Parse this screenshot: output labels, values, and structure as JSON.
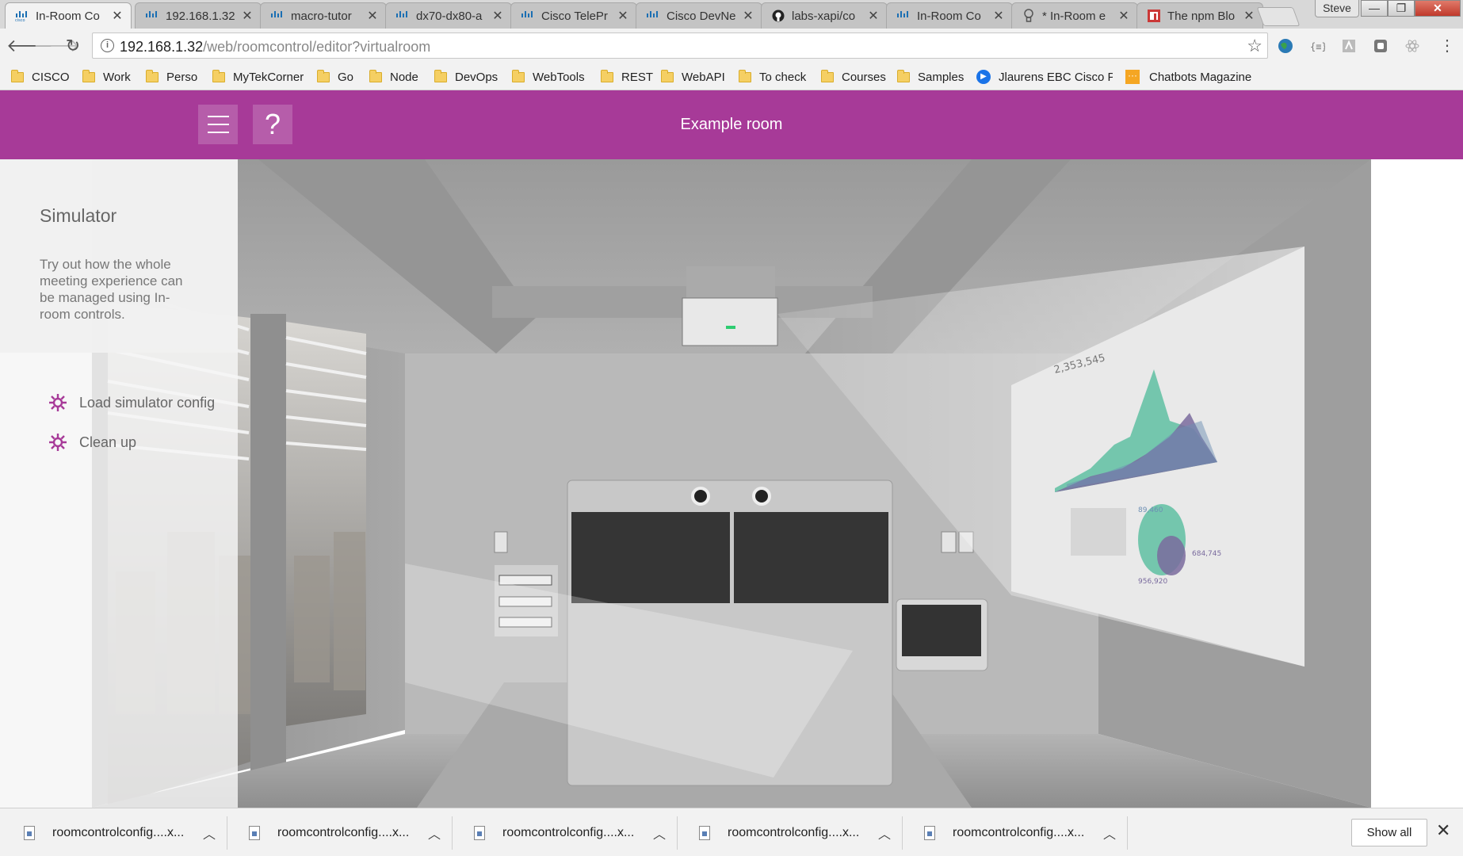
{
  "tabs": [
    {
      "title": "In-Room Co",
      "icon": "cisco-icon",
      "active": true
    },
    {
      "title": "192.168.1.32",
      "icon": "cisco-icon"
    },
    {
      "title": "macro-tutor",
      "icon": "cisco-icon"
    },
    {
      "title": "dx70-dx80-a",
      "icon": "cisco-icon"
    },
    {
      "title": "Cisco TelePr",
      "icon": "cisco-icon"
    },
    {
      "title": "Cisco DevNe",
      "icon": "cisco-icon"
    },
    {
      "title": "labs-xapi/co",
      "icon": "github-icon"
    },
    {
      "title": "In-Room Co",
      "icon": "cisco-icon"
    },
    {
      "title": "* In-Room e",
      "icon": "lightbulb-icon"
    },
    {
      "title": "The npm Blo",
      "icon": "npm-icon"
    }
  ],
  "window": {
    "profile": "Steve",
    "minimize": "—",
    "maximize": "❐",
    "close": "✕"
  },
  "address": {
    "host": "192.168.1.32",
    "path": "/web/roomcontrol/editor?virtualroom"
  },
  "bookmarks": [
    {
      "label": "CISCO"
    },
    {
      "label": "Work"
    },
    {
      "label": "Perso"
    },
    {
      "label": "MyTekCorner"
    },
    {
      "label": "Go"
    },
    {
      "label": "Node"
    },
    {
      "label": "DevOps"
    },
    {
      "label": "WebTools"
    },
    {
      "label": "REST"
    },
    {
      "label": "WebAPI"
    },
    {
      "label": "To check"
    },
    {
      "label": "Courses"
    },
    {
      "label": "Samples"
    },
    {
      "label": "Jlaurens EBC Cisco Pr"
    },
    {
      "label": "Chatbots Magazine"
    }
  ],
  "header": {
    "title": "Example room",
    "help_label": "?"
  },
  "sidebar": {
    "title": "Simulator",
    "description": "Try out how the whole meeting experience can be managed using In-room controls.",
    "actions": [
      {
        "label": "Load simulator config"
      },
      {
        "label": "Clean up"
      }
    ]
  },
  "screen_chart": {
    "top_value": "2,353,545",
    "bubble_value_1": "89,460",
    "bubble_value_2": "684,745",
    "bubble_value_3": "956,920"
  },
  "downloads": {
    "items": [
      {
        "name": "roomcontrolconfig....x..."
      },
      {
        "name": "roomcontrolconfig....x..."
      },
      {
        "name": "roomcontrolconfig....x..."
      },
      {
        "name": "roomcontrolconfig....x..."
      },
      {
        "name": "roomcontrolconfig....x..."
      }
    ],
    "show_all": "Show all"
  },
  "colors": {
    "accent": "#a73a98",
    "gear": "#a73a98"
  }
}
